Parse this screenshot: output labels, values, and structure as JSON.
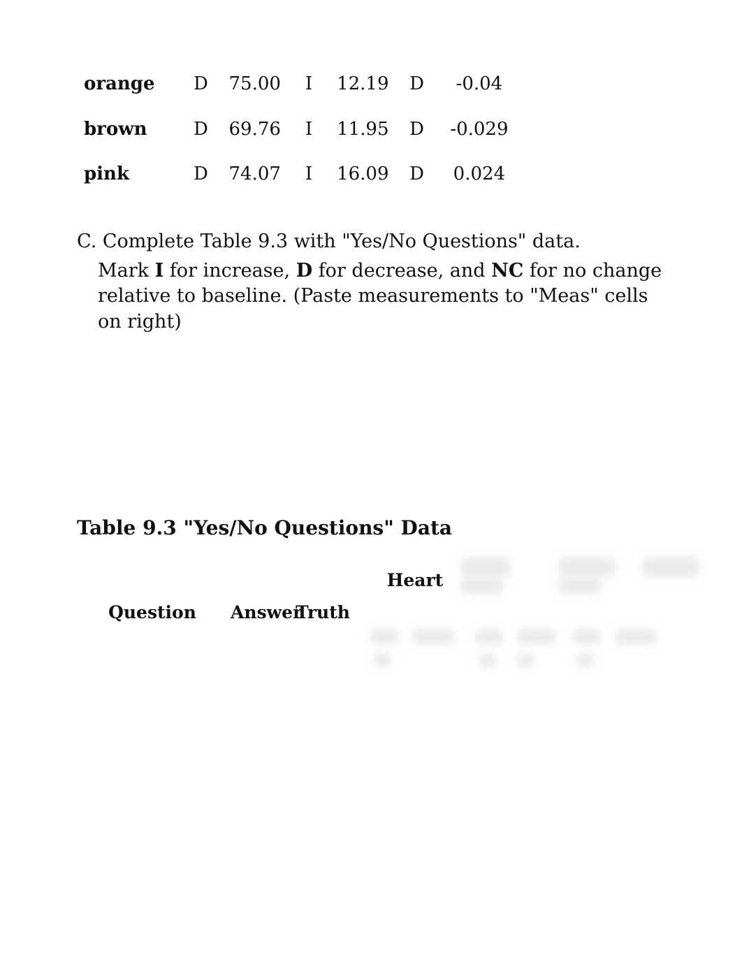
{
  "table92_rows": [
    {
      "label": "orange",
      "c1": "D",
      "c2": "75.00",
      "c3": "I",
      "c4": "12.19",
      "c5": "D",
      "c6": "-0.04"
    },
    {
      "label": "brown",
      "c1": "D",
      "c2": "69.76",
      "c3": "I",
      "c4": "11.95",
      "c5": "D",
      "c6": "-0.029"
    },
    {
      "label": "pink",
      "c1": "D",
      "c2": "74.07",
      "c3": "I",
      "c4": "16.09",
      "c5": "D",
      "c6": "0.024"
    }
  ],
  "section_c": {
    "lead": "C. Complete Table 9.3 with \"Yes/No Questions\" data.",
    "instr_pre": "Mark ",
    "instr_i": "I",
    "instr_mid1": " for increase, ",
    "instr_d": "D",
    "instr_mid2": " for decrease, and ",
    "instr_nc": "NC",
    "instr_post": " for no change relative to baseline. (Paste measurements to \"Meas\" cells on right)"
  },
  "table93_title": "Table 9.3 \"Yes/No Questions\" Data",
  "table93_headers": {
    "question": "Question",
    "answer": "Answer",
    "truth": "Truth",
    "heart": "Heart"
  }
}
